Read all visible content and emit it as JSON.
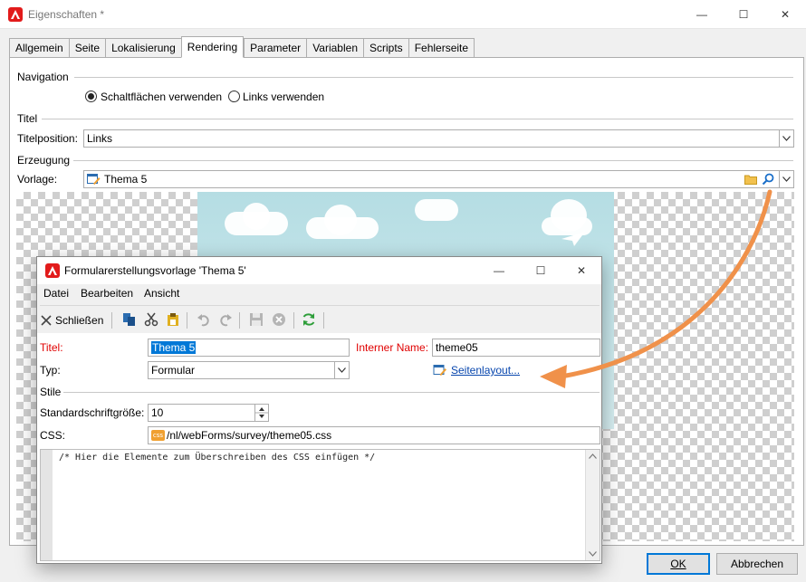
{
  "window": {
    "title": "Eigenschaften *",
    "minimize": "—",
    "maximize": "☐",
    "close": "✕"
  },
  "tabs": [
    "Allgemein",
    "Seite",
    "Lokalisierung",
    "Rendering",
    "Parameter",
    "Variablen",
    "Scripts",
    "Fehlerseite"
  ],
  "active_tab": "Rendering",
  "navigation": {
    "label": "Navigation",
    "option_buttons": "Schaltflächen verwenden",
    "option_links": "Links verwenden",
    "selected": "Schaltflächen verwenden"
  },
  "titel": {
    "section": "Titel",
    "position_label": "Titelposition:",
    "position_value": "Links"
  },
  "erzeugung": {
    "section": "Erzeugung",
    "vorlage_label": "Vorlage:",
    "vorlage_value": "Thema 5"
  },
  "footer": {
    "ok": "OK",
    "cancel": "Abbrechen"
  },
  "dialog": {
    "title": "Formularerstellungsvorlage 'Thema 5'",
    "menu": [
      "Datei",
      "Bearbeiten",
      "Ansicht"
    ],
    "toolbar_close": "Schließen",
    "titel_label": "Titel:",
    "titel_value": "Thema 5",
    "internal_name_label": "Interner Name:",
    "internal_name_value": "theme05",
    "typ_label": "Typ:",
    "typ_value": "Formular",
    "page_layout_link": "Seitenlayout...",
    "stile_section": "Stile",
    "font_size_label": "Standardschriftgröße:",
    "font_size_value": "10",
    "css_label": "CSS:",
    "css_badge": "css",
    "css_value": "/nl/webForms/survey/theme05.css",
    "editor_text": "/* Hier die Elemente zum Überschreiben des CSS einfügen */"
  },
  "colors": {
    "accent_red": "#e21b1b",
    "arrow_orange": "#f0914a",
    "link_blue": "#0645ad",
    "label_red": "#e00000"
  }
}
